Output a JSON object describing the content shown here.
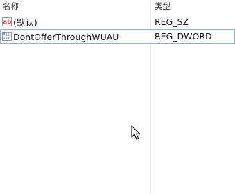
{
  "columns": {
    "name_header": "名称",
    "type_header": "类型"
  },
  "rows": [
    {
      "name": "(默认)",
      "type": "REG_SZ",
      "icon": "reg-sz-icon"
    },
    {
      "name": "DontOfferThroughWUAU",
      "type": "REG_DWORD",
      "icon": "reg-dword-icon"
    }
  ],
  "colors": {
    "selection_border": "#8ab3d8",
    "sz_icon_red": "#c83b3b",
    "dword_icon_blue": "#2f5fa8"
  }
}
